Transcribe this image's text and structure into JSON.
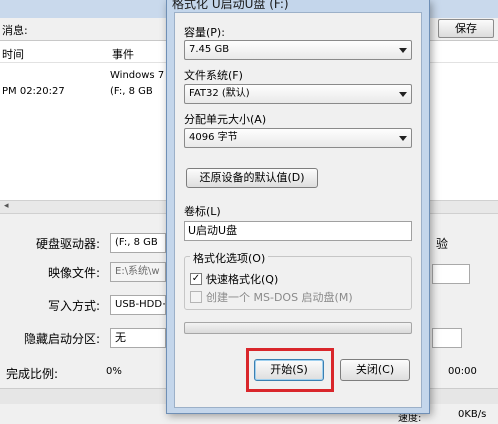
{
  "background": {
    "message_label": "消息:",
    "save_label": "保存",
    "log": {
      "col_time": "时间",
      "col_event": "事件",
      "rows": [
        {
          "time": "",
          "event": "Windows 7"
        },
        {
          "time": "PM 02:20:27",
          "event": "(F:, 8 GB"
        }
      ]
    },
    "fields": {
      "disk_label": "硬盘驱动器:",
      "disk_value": "(F:, 8 GB",
      "image_label": "映像文件:",
      "image_value": "E:\\系统\\w",
      "write_label": "写入方式:",
      "write_value": "USB-HDD+",
      "hidden_label": "隐藏启动分区:",
      "hidden_value": "无",
      "progress_label": "完成比例:",
      "progress_value": "0%",
      "verify_label": "验",
      "time_right_1": "00:00",
      "time_right_2": "00:00",
      "speed_label": "速度:",
      "speed_value": "0KB/s"
    }
  },
  "dialog": {
    "title": "格式化 U启动U盘 (F:)",
    "capacity_label": "容量(P):",
    "capacity_value": "7.45 GB",
    "fs_label": "文件系统(F)",
    "fs_value": "FAT32 (默认)",
    "alloc_label": "分配单元大小(A)",
    "alloc_value": "4096 字节",
    "restore_label": "还原设备的默认值(D)",
    "volume_label": "卷标(L)",
    "volume_value": "U启动U盘",
    "options_label": "格式化选项(O)",
    "quick_format_label": "快速格式化(Q)",
    "quick_format_checked": true,
    "msdos_label": "创建一个 MS-DOS 启动盘(M)",
    "msdos_checked": false,
    "start_label": "开始(S)",
    "close_label": "关闭(C)",
    "highlight_color": "#d9262b"
  }
}
